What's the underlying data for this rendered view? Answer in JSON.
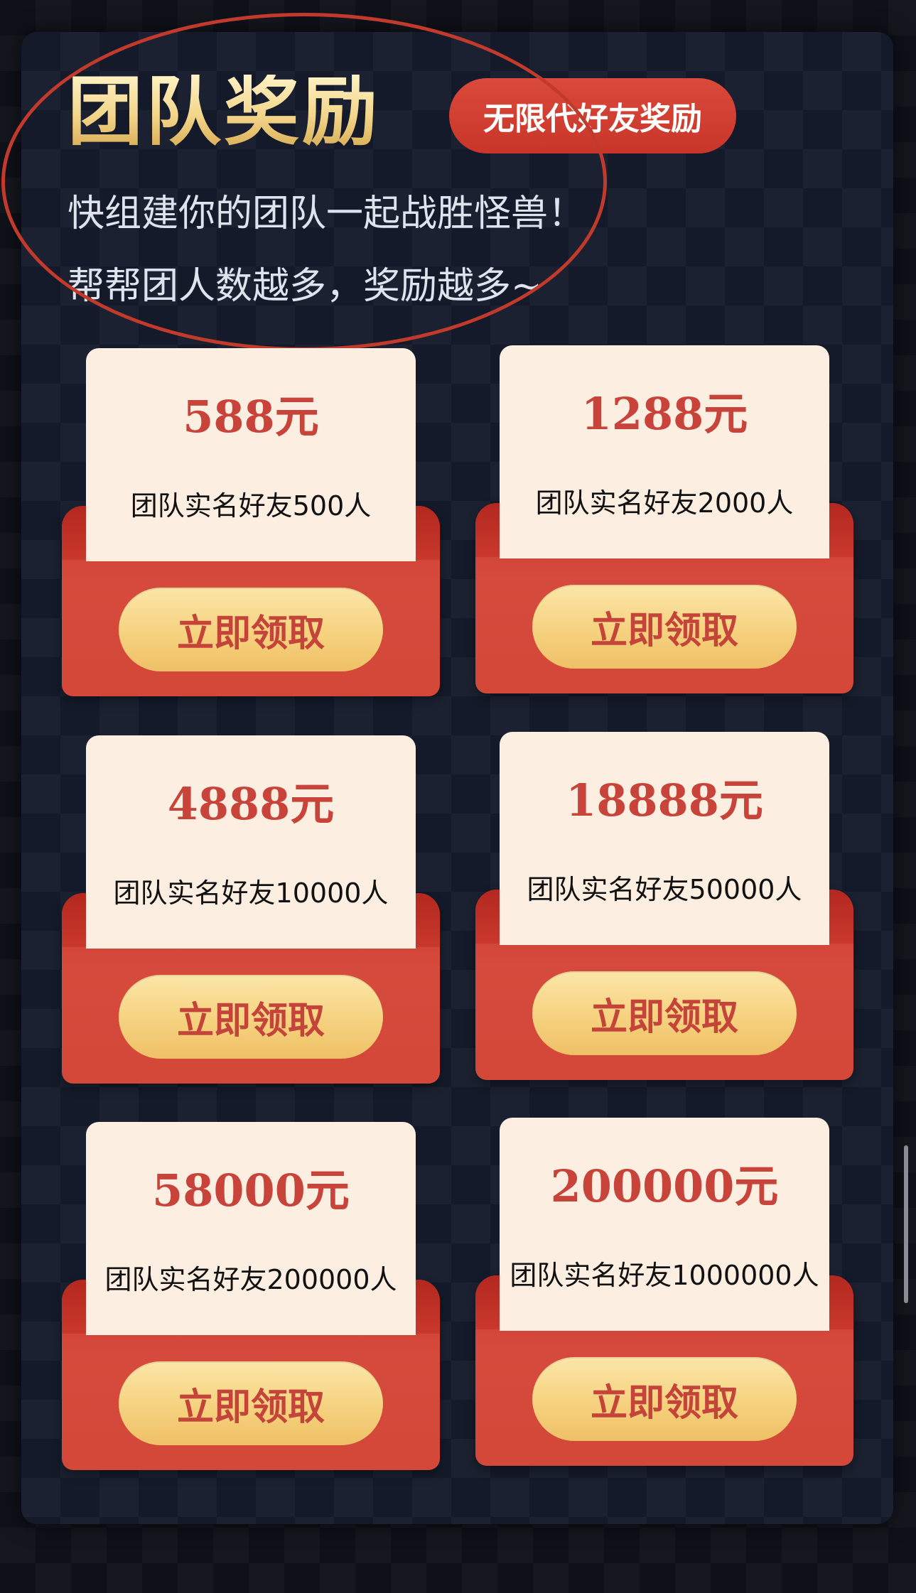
{
  "header": {
    "title": "团队奖励",
    "badge": "无限代好友奖励",
    "subtitle_1": "快组建你的团队一起战胜怪兽！",
    "subtitle_2": "帮帮团人数越多，奖励越多~"
  },
  "rewards": [
    {
      "amount": "588元",
      "condition": "团队实名好友500人",
      "button": "立即领取"
    },
    {
      "amount": "1288元",
      "condition": "团队实名好友2000人",
      "button": "立即领取"
    },
    {
      "amount": "4888元",
      "condition": "团队实名好友10000人",
      "button": "立即领取"
    },
    {
      "amount": "18888元",
      "condition": "团队实名好友50000人",
      "button": "立即领取"
    },
    {
      "amount": "58000元",
      "condition": "团队实名好友200000人",
      "button": "立即领取"
    },
    {
      "amount": "200000元",
      "condition": "团队实名好友1000000人",
      "button": "立即领取"
    }
  ],
  "colors": {
    "background": "#0f1119",
    "panel": "#141a29",
    "title_gold": "#f3d58a",
    "badge_red": "#d94a3a",
    "card_paper": "#fcefe2",
    "pocket_red": "#d34839",
    "amount_red": "#c8443a",
    "button_gold": "#f6d27f",
    "annotation_circle": "#c23a2c"
  }
}
